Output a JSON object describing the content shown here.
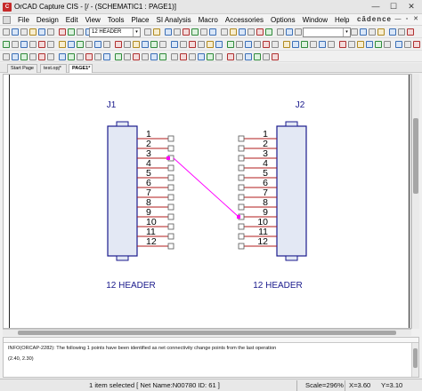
{
  "window": {
    "title": "OrCAD Capture CIS - [/ - (SCHEMATIC1 : PAGE1)]",
    "app_icon_label": "C",
    "min_label": "—",
    "max_label": "☐",
    "close_label": "✕"
  },
  "menubar": {
    "items": [
      "File",
      "Design",
      "Edit",
      "View",
      "Tools",
      "Place",
      "SI Analysis",
      "Macro",
      "Accessories",
      "Options",
      "Window",
      "Help"
    ],
    "brand": "cādence",
    "mdi_min": "—",
    "mdi_restore": "▫",
    "mdi_close": "✕"
  },
  "toolbar": {
    "part_combo_value": "12 HEADER",
    "combo_arrow": "▾",
    "search_combo_value": ""
  },
  "tabs": [
    {
      "label": "Start Page",
      "active": false
    },
    {
      "label": "test.opj*",
      "active": false
    },
    {
      "label": "PAGE1*",
      "active": true
    }
  ],
  "schematic": {
    "left_ref": "J1",
    "right_ref": "J2",
    "left_value": "12 HEADER",
    "right_value": "12 HEADER",
    "left_pins": [
      "1",
      "2",
      "3",
      "4",
      "5",
      "6",
      "7",
      "8",
      "9",
      "10",
      "11",
      "12"
    ],
    "right_pins": [
      "1",
      "2",
      "3",
      "4",
      "5",
      "6",
      "7",
      "8",
      "9",
      "10",
      "11",
      "12"
    ],
    "colors": {
      "ref_text": "#1a1a8c",
      "pin_line": "#b11b1b",
      "body_outline": "#1a1a8c",
      "body_fill": "#e3e8f4",
      "wire": "#ff00ff",
      "pin_number": "#000000"
    }
  },
  "session_log": {
    "lines": [
      "INFO(ORCAP-2282): The following 1 points have been identified as net connectivity change points from the last operation",
      "(2.40, 2.30)"
    ]
  },
  "status": {
    "selection": "1 item selected [ Net Name:N00780 ID: 61 ]",
    "scale": "Scale=296%",
    "x": "X=3.60",
    "y": "Y=3.10"
  }
}
